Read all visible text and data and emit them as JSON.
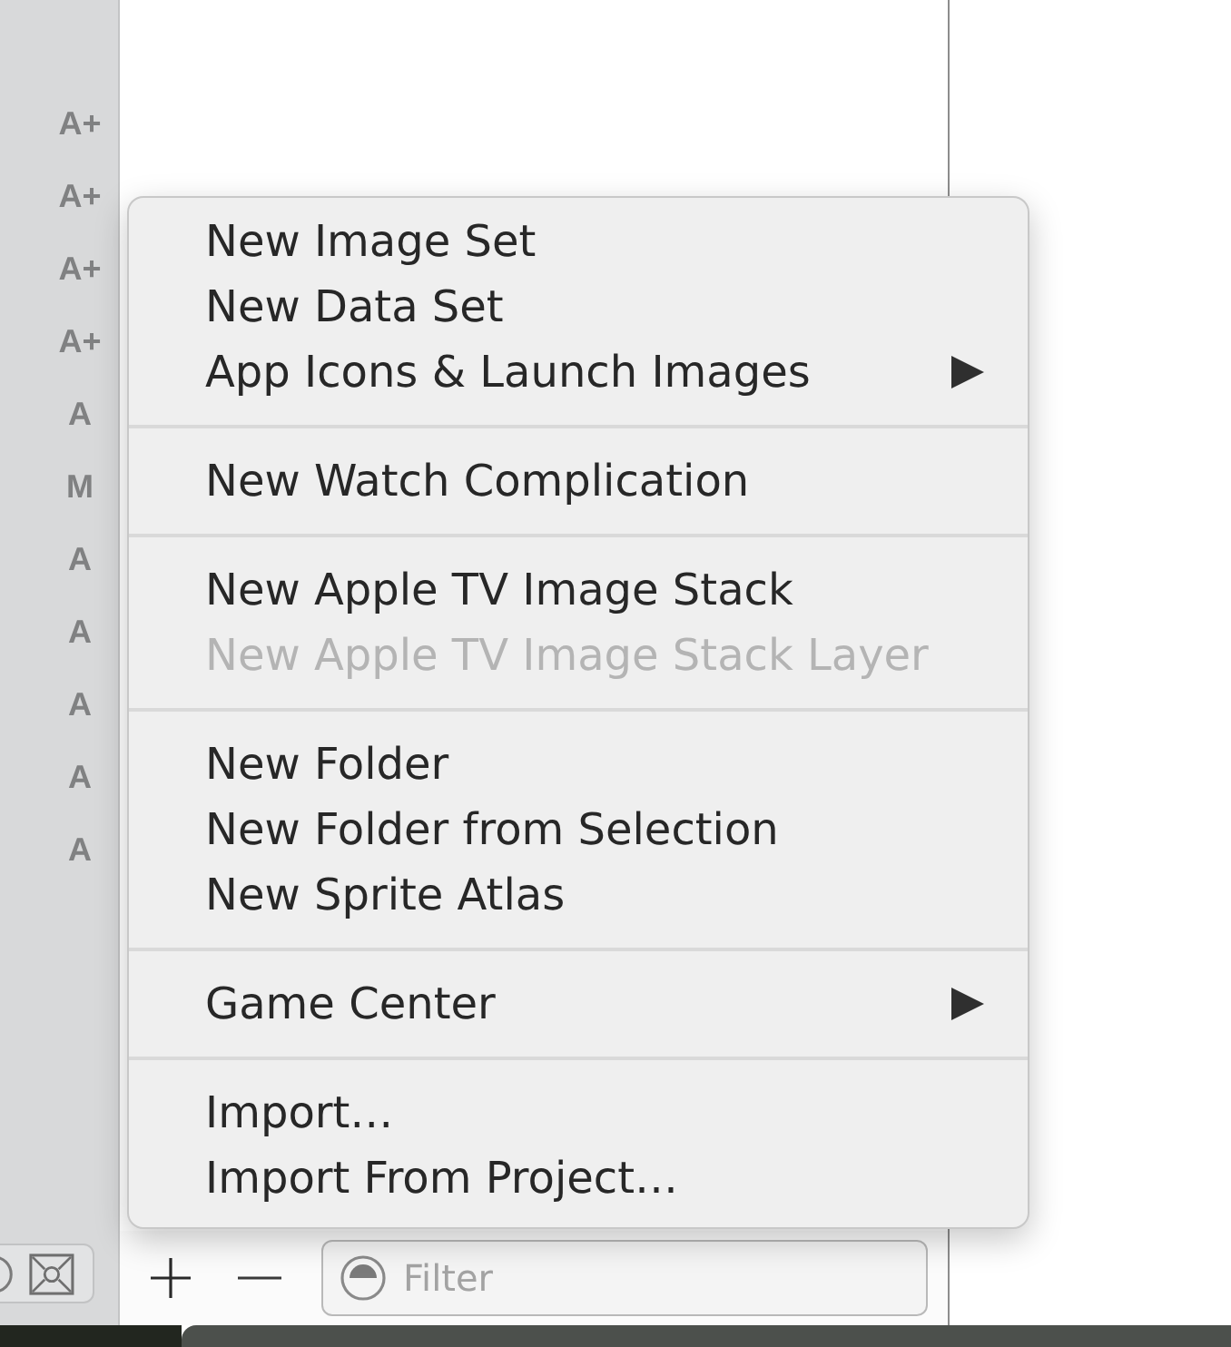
{
  "sidebar": {
    "status_letters": [
      "A+",
      "A+",
      "A+",
      "A+",
      "A",
      "M",
      "A",
      "A",
      "A",
      "A",
      "A"
    ]
  },
  "context_menu": {
    "groups": [
      {
        "items": [
          {
            "label": "New Image Set",
            "disabled": false,
            "submenu": false
          },
          {
            "label": "New Data Set",
            "disabled": false,
            "submenu": false
          },
          {
            "label": "App Icons & Launch Images",
            "disabled": false,
            "submenu": true
          }
        ]
      },
      {
        "items": [
          {
            "label": "New Watch Complication",
            "disabled": false,
            "submenu": false
          }
        ]
      },
      {
        "items": [
          {
            "label": "New Apple TV Image Stack",
            "disabled": false,
            "submenu": false
          },
          {
            "label": "New Apple TV Image Stack Layer",
            "disabled": true,
            "submenu": false
          }
        ]
      },
      {
        "items": [
          {
            "label": "New Folder",
            "disabled": false,
            "submenu": false
          },
          {
            "label": "New Folder from Selection",
            "disabled": false,
            "submenu": false
          },
          {
            "label": "New Sprite Atlas",
            "disabled": false,
            "submenu": false
          }
        ]
      },
      {
        "items": [
          {
            "label": "Game Center",
            "disabled": false,
            "submenu": true
          }
        ]
      },
      {
        "items": [
          {
            "label": "Import…",
            "disabled": false,
            "submenu": false
          },
          {
            "label": "Import From Project…",
            "disabled": false,
            "submenu": false
          }
        ]
      }
    ]
  },
  "bottom_bar": {
    "filter": {
      "placeholder": "Filter"
    }
  }
}
